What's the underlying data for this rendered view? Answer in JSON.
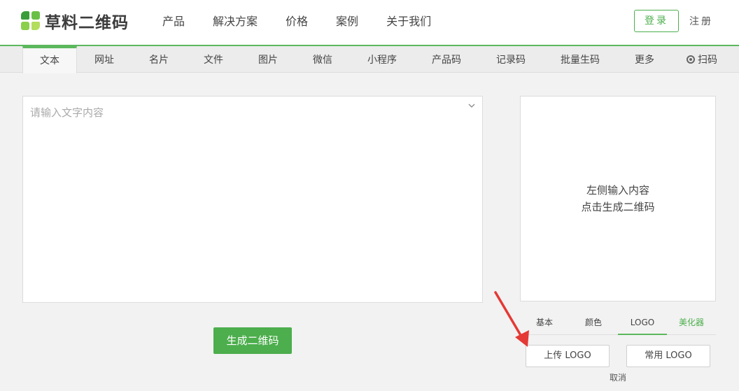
{
  "brand": {
    "name": "草料二维码"
  },
  "nav": {
    "items": [
      "产品",
      "解决方案",
      "价格",
      "案例",
      "关于我们"
    ]
  },
  "account": {
    "login": "登录",
    "register": "注册"
  },
  "tabs": [
    "文本",
    "网址",
    "名片",
    "文件",
    "图片",
    "微信",
    "小程序",
    "产品码",
    "记录码",
    "批量生码",
    "更多",
    "扫码"
  ],
  "editor": {
    "placeholder": "请输入文字内容",
    "value": ""
  },
  "generate_button": "生成二维码",
  "preview": {
    "line1": "左侧输入内容",
    "line2": "点击生成二维码"
  },
  "style_tabs": [
    "基本",
    "颜色",
    "LOGO",
    "美化器"
  ],
  "logo_options": {
    "upload": "上传 LOGO",
    "common": "常用 LOGO",
    "cancel": "取消"
  },
  "colors": {
    "accent": "#4cae4c",
    "annotation_arrow": "#e53935"
  },
  "icons": {
    "logo": "qr-brand-icon",
    "dropdown": "chevron-down-icon",
    "scan": "scan-icon",
    "annotation": "red-arrow-icon"
  }
}
